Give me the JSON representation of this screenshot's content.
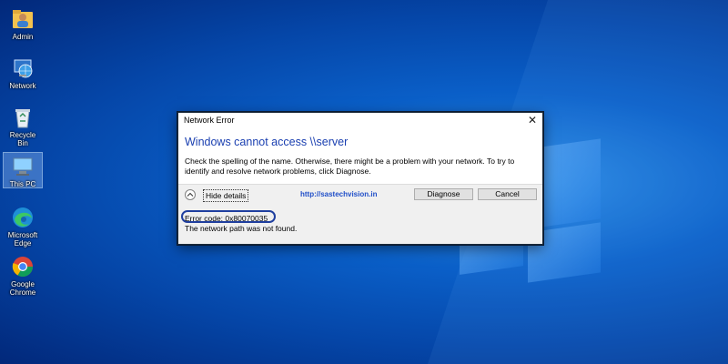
{
  "desktop": {
    "icons": [
      {
        "label": "Admin",
        "icon": "user-folder-icon"
      },
      {
        "label": "Network",
        "icon": "network-globe-icon"
      },
      {
        "label": "Recycle Bin",
        "icon": "recycle-bin-icon"
      },
      {
        "label": "This PC",
        "icon": "computer-icon"
      },
      {
        "label": "Microsoft Edge",
        "icon": "edge-browser-icon"
      },
      {
        "label": "Google Chrome",
        "icon": "chrome-browser-icon"
      }
    ]
  },
  "dialog": {
    "title": "Network Error",
    "close_glyph": "✕",
    "heading": "Windows cannot access \\\\server",
    "body": "Check the spelling of the name. Otherwise, there might be a problem with your network. To try to identify and resolve network problems, click Diagnose.",
    "hide_details_label": "Hide details",
    "watermark_url": "http://sastechvision.in",
    "diagnose_label": "Diagnose",
    "cancel_label": "Cancel",
    "error_code": "Error code: 0x80070035",
    "error_message": "The network path was not found."
  },
  "colors": {
    "heading": "#1a3fb0",
    "desktop_bg": "#0a5fc8",
    "highlight_ring": "#1f3f9f"
  }
}
